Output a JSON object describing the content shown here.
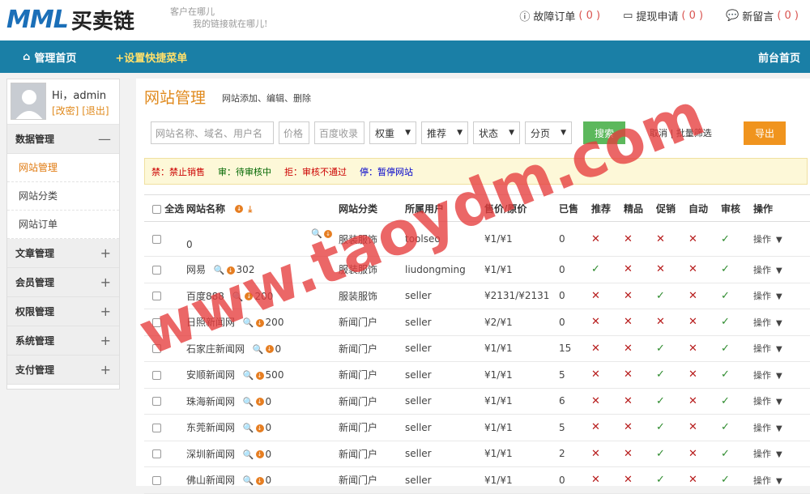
{
  "header": {
    "logo_mark": "MML",
    "logo_text": "买卖链",
    "slogan_line1": "客户在哪儿",
    "slogan_line2": "我的链接就在哪儿!",
    "links": [
      {
        "label": "故障订单",
        "count": "( 0 )",
        "icon": "warning-icon"
      },
      {
        "label": "提现申请",
        "count": "( 0 )",
        "icon": "card-icon"
      },
      {
        "label": "新留言",
        "count": "( 0 )",
        "icon": "chat-icon"
      }
    ]
  },
  "nav": {
    "home": "管理首页",
    "quick": "+设置快捷菜单",
    "front": "前台首页"
  },
  "sidebar": {
    "greeting": "Hi，admin",
    "change": "[改密]",
    "logout": "[退出]",
    "groups": [
      {
        "label": "数据管理",
        "sign": "—",
        "items": [
          "网站管理",
          "网站分类",
          "网站订单"
        ]
      },
      {
        "label": "文章管理",
        "sign": "+"
      },
      {
        "label": "会员管理",
        "sign": "+"
      },
      {
        "label": "权限管理",
        "sign": "+"
      },
      {
        "label": "系统管理",
        "sign": "+"
      },
      {
        "label": "支付管理",
        "sign": "+"
      }
    ]
  },
  "page": {
    "title": "网站管理",
    "subtitle": "网站添加、编辑、删除"
  },
  "filters": {
    "name_placeholder": "网站名称、域名、用户名",
    "price_placeholder": "价格",
    "baidu_placeholder": "百度收录",
    "weight": "权重",
    "recommend": "推荐",
    "status": "状态",
    "page": "分页",
    "search": "搜索",
    "cancel": "取消",
    "batch": "批量筛选",
    "export": "导出"
  },
  "legend": {
    "ban": "禁：禁止销售",
    "review": "审：待审核中",
    "reject": "拒：审核不通过",
    "pause": "停：暂停网站"
  },
  "table": {
    "headers": [
      "全选",
      "网站名称",
      "网站分类",
      "所属用户",
      "售价/原价",
      "已售",
      "推荐",
      "精品",
      "促销",
      "自动",
      "审核",
      "操作"
    ],
    "rows": [
      {
        "name": "",
        "rank": "0",
        "cat": "服装服饰",
        "user": "toolseo",
        "price": "¥1/¥1",
        "sold": "0",
        "flags": [
          0,
          0,
          0,
          0,
          1
        ]
      },
      {
        "name": "网易",
        "rank": "302",
        "cat": "服装服饰",
        "user": "liudongming",
        "price": "¥1/¥1",
        "sold": "0",
        "flags": [
          1,
          0,
          0,
          0,
          1
        ]
      },
      {
        "name": "百度888",
        "rank": "200",
        "cat": "服装服饰",
        "user": "seller",
        "price": "¥2131/¥2131",
        "sold": "0",
        "flags": [
          0,
          0,
          1,
          0,
          1
        ]
      },
      {
        "name": "日照新闻网",
        "rank": "200",
        "cat": "新闻门户",
        "user": "seller",
        "price": "¥2/¥1",
        "sold": "0",
        "flags": [
          0,
          0,
          0,
          0,
          1
        ]
      },
      {
        "name": "石家庄新闻网",
        "rank": "0",
        "cat": "新闻门户",
        "user": "seller",
        "price": "¥1/¥1",
        "sold": "15",
        "flags": [
          0,
          0,
          1,
          0,
          1
        ]
      },
      {
        "name": "安顺新闻网",
        "rank": "500",
        "cat": "新闻门户",
        "user": "seller",
        "price": "¥1/¥1",
        "sold": "5",
        "flags": [
          0,
          0,
          1,
          0,
          1
        ]
      },
      {
        "name": "珠海新闻网",
        "rank": "0",
        "cat": "新闻门户",
        "user": "seller",
        "price": "¥1/¥1",
        "sold": "6",
        "flags": [
          0,
          0,
          1,
          0,
          1
        ]
      },
      {
        "name": "东莞新闻网",
        "rank": "0",
        "cat": "新闻门户",
        "user": "seller",
        "price": "¥1/¥1",
        "sold": "5",
        "flags": [
          0,
          0,
          1,
          0,
          1
        ]
      },
      {
        "name": "深圳新闻网",
        "rank": "0",
        "cat": "新闻门户",
        "user": "seller",
        "price": "¥1/¥1",
        "sold": "2",
        "flags": [
          0,
          0,
          1,
          0,
          1
        ]
      },
      {
        "name": "佛山新闻网",
        "rank": "0",
        "cat": "新闻门户",
        "user": "seller",
        "price": "¥1/¥1",
        "sold": "0",
        "flags": [
          0,
          0,
          1,
          0,
          1
        ]
      }
    ],
    "op_label": "操作"
  },
  "watermark": "www.taoydm.com"
}
